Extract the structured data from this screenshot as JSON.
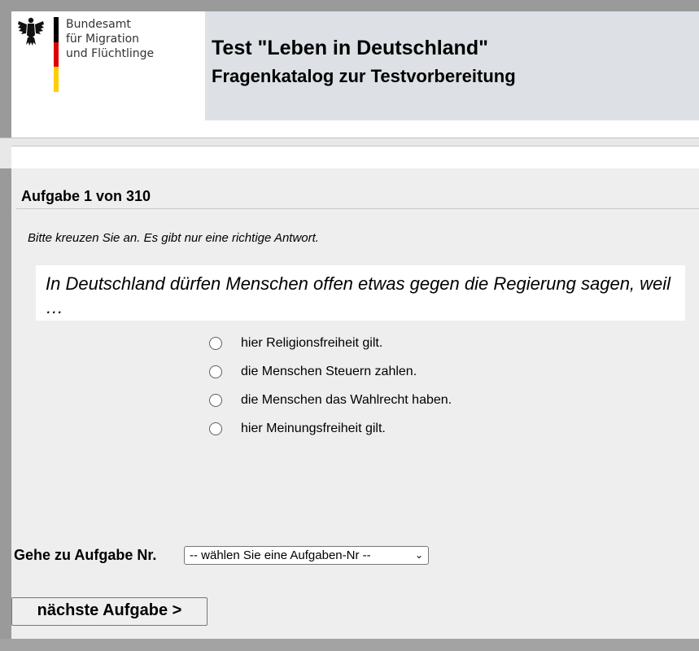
{
  "header": {
    "org_lines": [
      "Bundesamt",
      "für Migration",
      "und Flüchtlinge"
    ],
    "title": "Test \"Leben in Deutschland\"",
    "subtitle": "Fragenkatalog zur Testvorbereitung",
    "flag_colors": [
      "#000000",
      "#dd0000",
      "#ffce00"
    ]
  },
  "task": {
    "heading": "Aufgabe 1 von 310",
    "instruction": "Bitte kreuzen Sie an. Es gibt nur eine richtige Antwort.",
    "question": "In Deutschland dürfen Menschen offen etwas gegen die Regierung sagen, weil …",
    "answers": [
      {
        "label": "hier Religionsfreiheit gilt.",
        "selected": false
      },
      {
        "label": "die Menschen Steuern zahlen.",
        "selected": false
      },
      {
        "label": "die Menschen das Wahlrecht haben.",
        "selected": false
      },
      {
        "label": "hier Meinungsfreiheit gilt.",
        "selected": false
      }
    ]
  },
  "navigation": {
    "goto_label": "Gehe zu Aufgabe Nr.",
    "goto_selected": "-- wählen Sie eine Aufgaben-Nr --",
    "next_label": "nächste Aufgabe >"
  }
}
